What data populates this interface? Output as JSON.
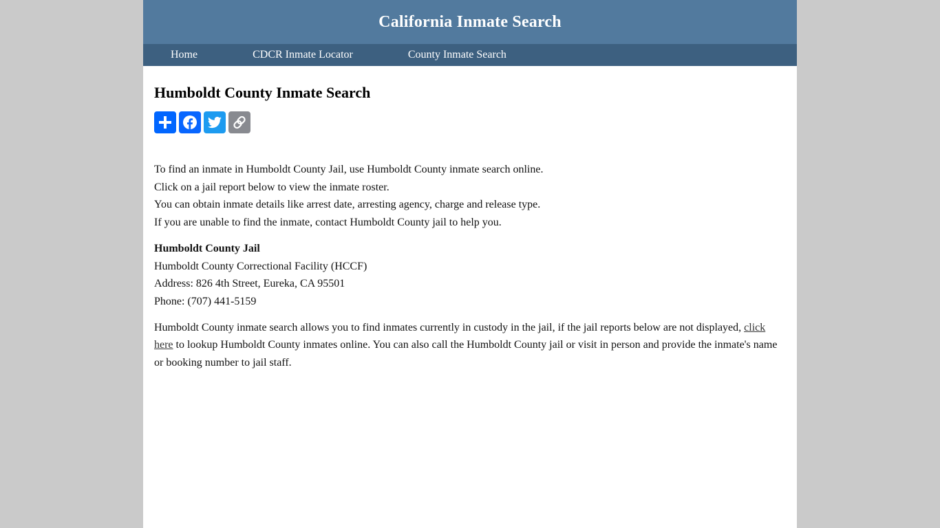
{
  "header": {
    "site_title": "California Inmate Search"
  },
  "nav": {
    "items": [
      {
        "label": "Home"
      },
      {
        "label": "CDCR Inmate Locator"
      },
      {
        "label": "County Inmate Search"
      }
    ]
  },
  "main": {
    "title": "Humboldt County Inmate Search",
    "share_buttons": [
      {
        "name": "share",
        "icon": "plus-icon",
        "color": "#0166ff"
      },
      {
        "name": "facebook",
        "icon": "facebook-icon",
        "color": "#0866ff"
      },
      {
        "name": "twitter",
        "icon": "twitter-icon",
        "color": "#1d9bf0"
      },
      {
        "name": "copy-link",
        "icon": "link-icon",
        "color": "#888a90"
      }
    ],
    "intro_lines": [
      "To find an inmate in Humboldt County Jail, use Humboldt County inmate search online.",
      "Click on a jail report below to view the inmate roster.",
      "You can obtain inmate details like arrest date, arresting agency, charge and release type.",
      "If you are unable to find the inmate, contact Humboldt County jail to help you."
    ],
    "jail": {
      "name": "Humboldt County Jail",
      "facility": "Humboldt County Correctional Facility (HCCF)",
      "address": "Address: 826 4th Street, Eureka, CA 95501",
      "phone": "Phone: (707) 441-5159"
    },
    "paragraph": {
      "before_link": "Humboldt County inmate search allows you to find inmates currently in custody in the jail, if the jail reports below are not displayed, ",
      "link_text": "click here",
      "after_link": " to lookup Humboldt County inmates online. You can also call the Humboldt County jail or visit in person and provide the inmate's name or booking number to jail staff."
    }
  }
}
